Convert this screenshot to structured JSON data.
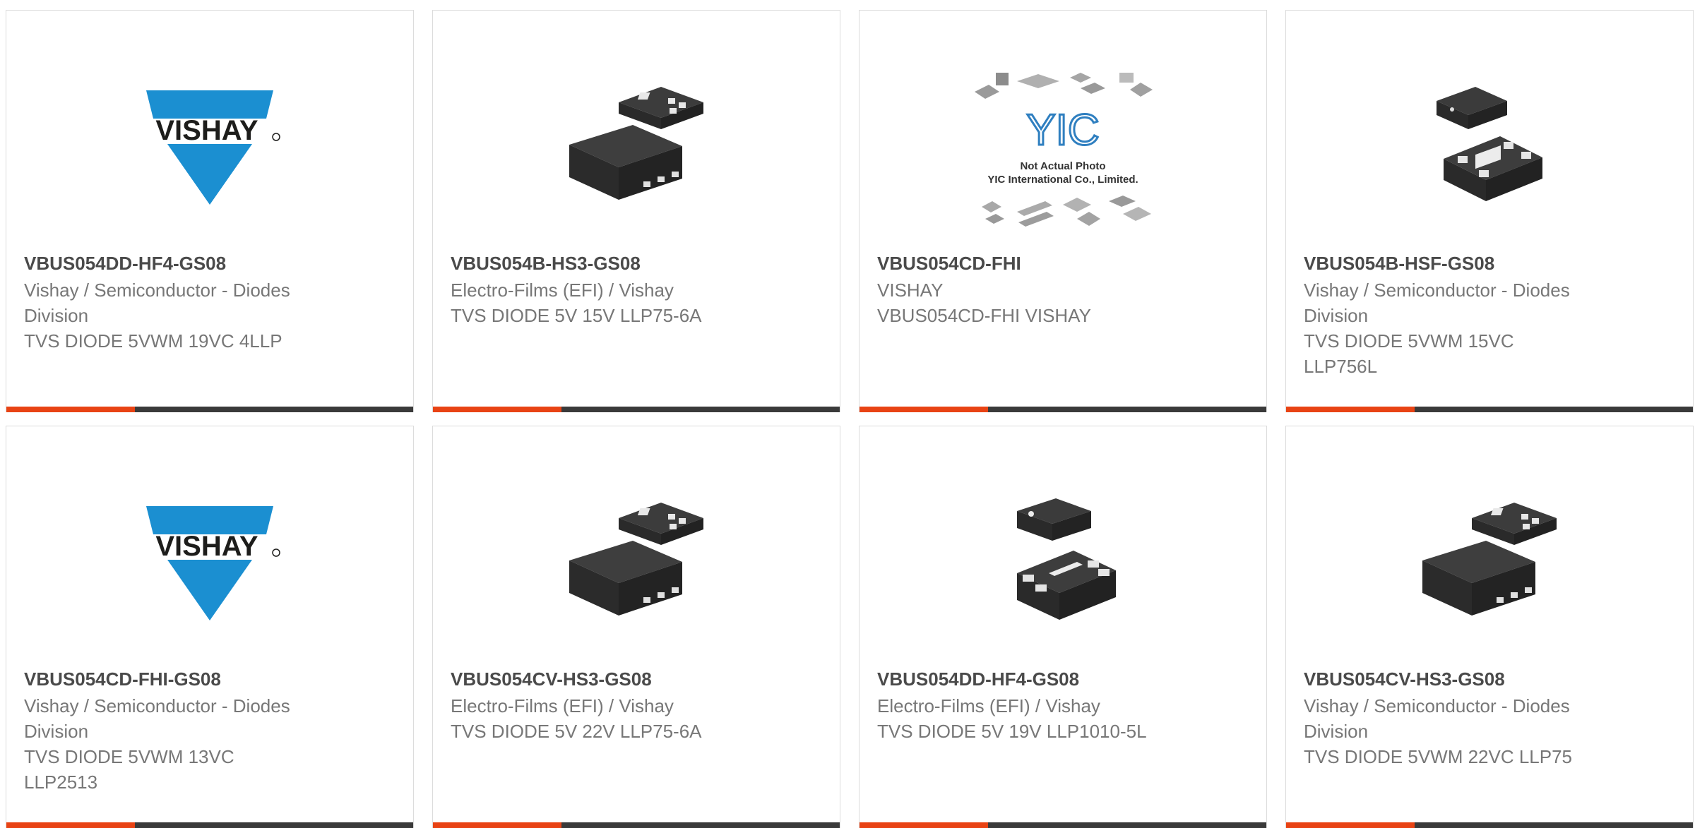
{
  "colors": {
    "accent": "#e84314",
    "bar": "#3a3a3a",
    "vishay_blue": "#1b8fd1"
  },
  "cards": [
    {
      "image": "vishay-logo",
      "logo_text": "VISHAY",
      "part_number": "VBUS054DD-HF4-GS08",
      "lines": [
        "Vishay / Semiconductor - Diodes",
        "Division",
        "TVS DIODE 5VWM 19VC 4LLP"
      ]
    },
    {
      "image": "chip-pair-a",
      "part_number": "VBUS054B-HS3-GS08",
      "lines": [
        "Electro-Films (EFI) / Vishay",
        "TVS DIODE 5V 15V LLP75-6A"
      ]
    },
    {
      "image": "yic-placeholder",
      "yic_logo": "YIC",
      "yic_caption_1": "Not Actual Photo",
      "yic_caption_2": "YIC International Co., Limited.",
      "part_number": "VBUS054CD-FHI",
      "lines": [
        "VISHAY",
        "VBUS054CD-FHI VISHAY"
      ]
    },
    {
      "image": "chip-pair-b",
      "part_number": "VBUS054B-HSF-GS08",
      "lines": [
        "Vishay / Semiconductor - Diodes",
        "Division",
        "TVS DIODE 5VWM 15VC",
        "LLP756L"
      ]
    },
    {
      "image": "vishay-logo",
      "logo_text": "VISHAY",
      "part_number": "VBUS054CD-FHI-GS08",
      "lines": [
        "Vishay / Semiconductor - Diodes",
        "Division",
        "TVS DIODE 5VWM 13VC",
        "LLP2513"
      ]
    },
    {
      "image": "chip-pair-a",
      "part_number": "VBUS054CV-HS3-GS08",
      "lines": [
        "Electro-Films (EFI) / Vishay",
        "TVS DIODE 5V 22V LLP75-6A"
      ]
    },
    {
      "image": "chip-pair-c",
      "part_number": "VBUS054DD-HF4-GS08",
      "lines": [
        "Electro-Films (EFI) / Vishay",
        "TVS DIODE 5V 19V LLP1010-5L"
      ]
    },
    {
      "image": "chip-pair-a",
      "part_number": "VBUS054CV-HS3-GS08",
      "lines": [
        "Vishay / Semiconductor - Diodes",
        "Division",
        "TVS DIODE 5VWM 22VC LLP75"
      ]
    }
  ]
}
